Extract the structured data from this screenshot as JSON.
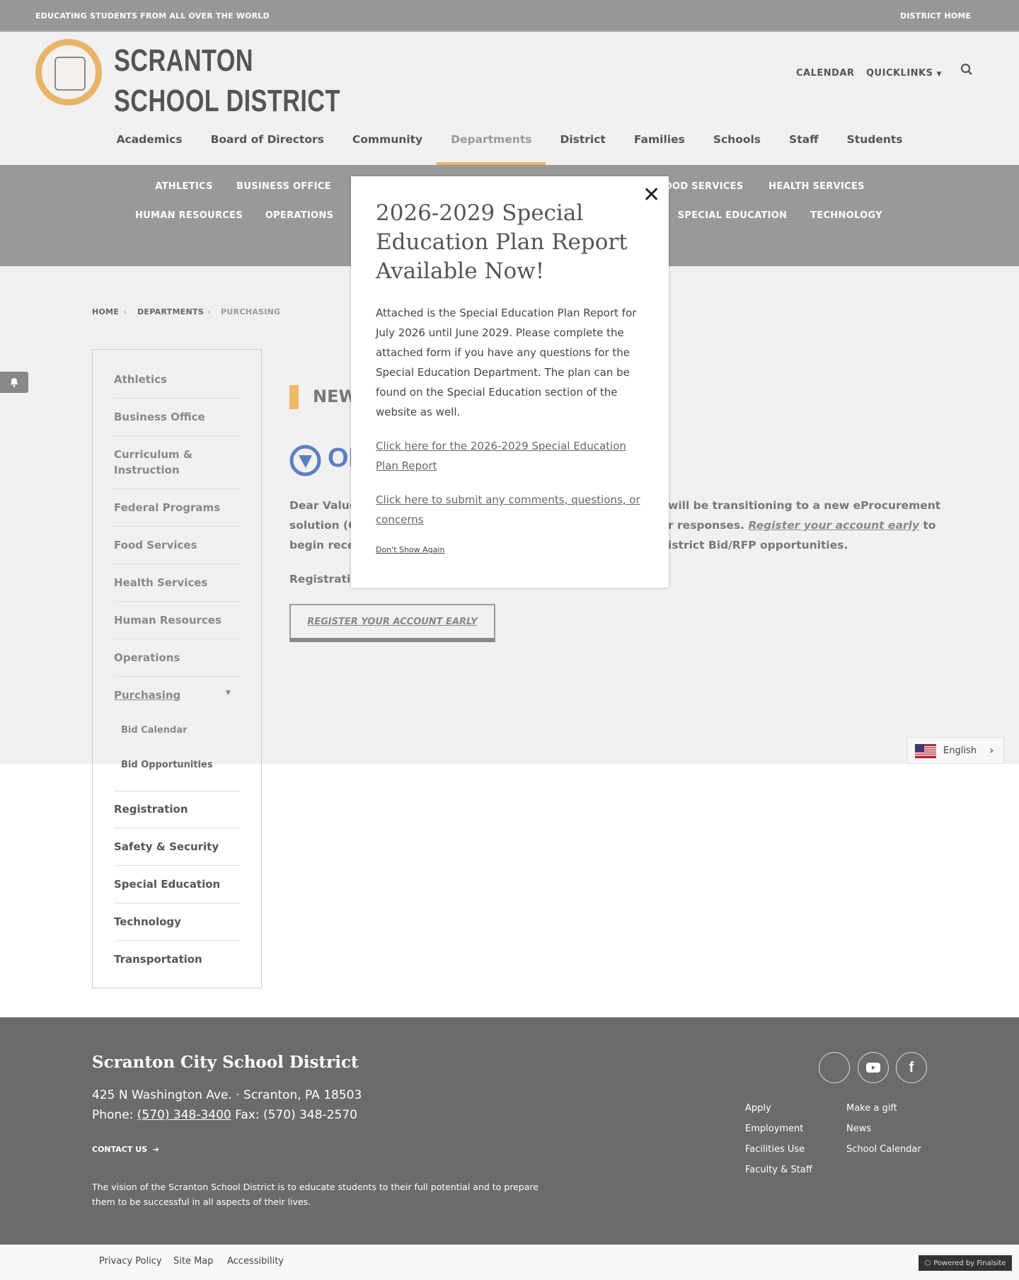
{
  "topbar": {
    "tagline": "EDUCATING STUDENTS FROM ALL OVER THE WORLD",
    "district_home": "DISTRICT HOME"
  },
  "header": {
    "brand_line1": "SCRANTON",
    "brand_line2": "SCHOOL DISTRICT",
    "calendar": "CALENDAR",
    "quicklinks": "QUICKLINKS"
  },
  "nav": [
    "Academics",
    "Board of Directors",
    "Community",
    "Departments",
    "District",
    "Families",
    "Schools",
    "Staff",
    "Students"
  ],
  "subnav": {
    "row1": [
      "ATHLETICS",
      "BUSINESS OFFICE",
      "FOOD SERVICES",
      "HEALTH SERVICES"
    ],
    "row2": [
      "HUMAN RESOURCES",
      "OPERATIONS",
      "SPECIAL EDUCATION",
      "TECHNOLOGY"
    ]
  },
  "breadcrumb": [
    "HOME",
    "DEPARTMENTS",
    "PURCHASING"
  ],
  "sidebar": {
    "items": [
      "Athletics",
      "Business Office",
      "Curriculum & Instruction",
      "Federal Programs",
      "Food Services",
      "Health Services",
      "Human Resources",
      "Operations",
      "Purchasing"
    ],
    "sub": [
      "Bid Calendar",
      "Bid Opportunities"
    ],
    "items_after": [
      "Registration",
      "Safety & Security",
      "Special Education",
      "Technology",
      "Transportation"
    ]
  },
  "main": {
    "heading": "NEW",
    "logo_text": "OP",
    "p1_left": "Dear Value",
    "p1_right": "will be transitioning to a new eProcurement",
    "p2_left": "solution (O",
    "p2_right": "r responses.",
    "p2_link": "Register your account early",
    "p2_end": "to",
    "p3_left": "begin recei",
    "p3_right": "istrict Bid/RFP opportunities.",
    "reg_label": "Registratio",
    "button": "REGISTER YOUR ACCOUNT EARLY"
  },
  "modal": {
    "title": "2026-2029 Special Education Plan Report Available Now!",
    "body": "Attached is the Special Education Plan Report for July 2026 until June 2029. Please complete the attached form if you have any questions for the Special Education Department. The plan can be found on the Special Education section of the website as well.",
    "link1": "Click here for the 2026-2029 Special Education Plan Report",
    "link2": "Click here to submit any comments, questions, or concerns",
    "dont_show": "Don't Show Again"
  },
  "language": "English",
  "footer": {
    "title": "Scranton City School District",
    "address": "425 N Washington Ave.  · Scranton, PA  18503",
    "phone_label": "Phone:",
    "phone": "(570) 348-3400",
    "fax": "Fax: (570) 348-2570",
    "contact": "CONTACT US",
    "vision": "The vision of the Scranton School District is to educate students to their full potential and to prepare them to be successful in all aspects of their lives.",
    "links_col1": [
      "Apply",
      "Employment",
      "Facilities Use",
      "Faculty & Staff"
    ],
    "links_col2": [
      "Make a gift",
      "News",
      "School Calendar"
    ]
  },
  "bottom": {
    "links": [
      "Privacy Policy",
      "Site Map",
      "Accessibility"
    ],
    "powered": "Powered by Finalsite"
  }
}
